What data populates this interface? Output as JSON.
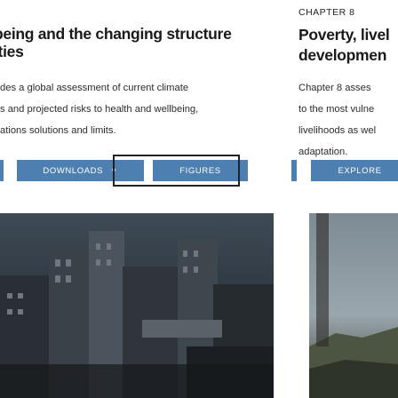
{
  "left_card": {
    "title_line1": "being and the changing structure",
    "title_line2": "ities",
    "description_lines": [
      "des a global assessment of current climate",
      "s and projected risks to health and wellbeing,",
      "ations solutions and limits."
    ],
    "buttons": {
      "downloads": "DOWNLOADS",
      "figures": "FIGURES"
    },
    "chevron_icon": "chevron-down-icon"
  },
  "right_card": {
    "chapter_label": "CHAPTER 8",
    "title_line1": "Poverty, livel",
    "title_line2": "developmen",
    "description_lines": [
      "Chapter 8 asses",
      "to the most vulne",
      "livelihoods as wel",
      "adaptation."
    ],
    "buttons": {
      "explore": "EXPLORE"
    }
  },
  "colors": {
    "button_bg": "#4d7fb0",
    "button_text": "#ffffff",
    "focus_frame": "#222222"
  }
}
